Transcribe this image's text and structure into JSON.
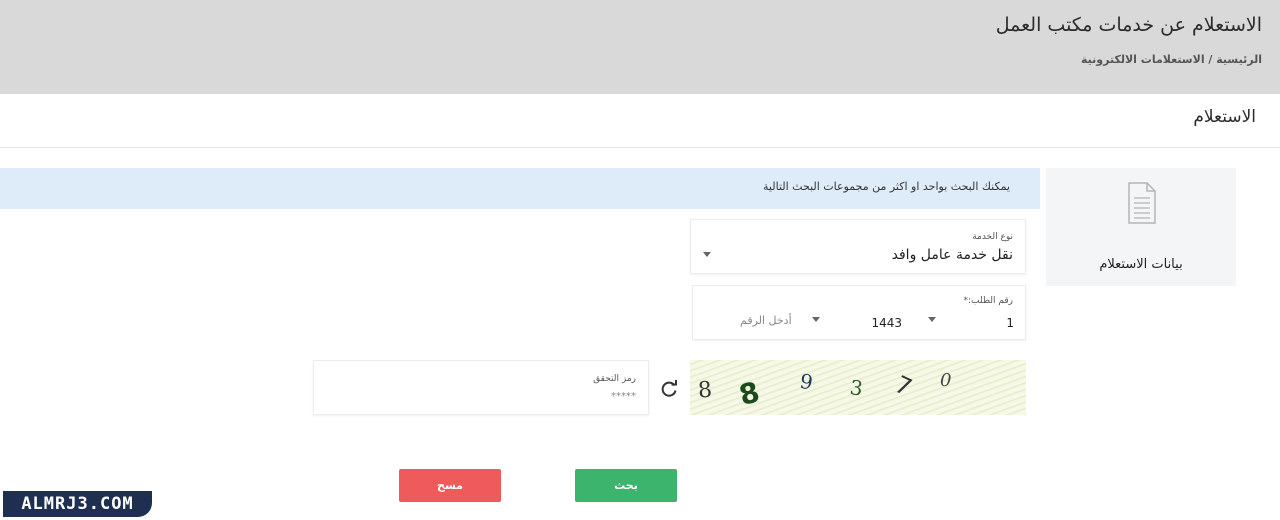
{
  "header": {
    "title": "الاستعلام عن خدمات مكتب العمل",
    "breadcrumb": "الرئيسية / الاستعلامات الالكترونية"
  },
  "card": {
    "title": "الاستعلام"
  },
  "side_tab": {
    "label": "بيانات الاستعلام",
    "icon": "document-icon"
  },
  "info_banner": {
    "text": "يمكنك البحث بواحد او اكثر من مجموعات البحث التالية"
  },
  "service_type": {
    "label": "نوع الخدمة",
    "value": "نقل خدمة عامل وافد"
  },
  "request_number": {
    "label": "رقم الطلب:*",
    "part1": "1",
    "year": "1443",
    "placeholder": "أدخل الرقم"
  },
  "captcha": {
    "digits": [
      "8",
      "8",
      "9",
      "3",
      "7",
      "0"
    ],
    "label": "رمز التحقق",
    "value": "*****"
  },
  "buttons": {
    "search": "بحث",
    "clear": "مسح"
  },
  "watermark": "ALMRJ3.COM",
  "colors": {
    "search_button": "#3cb46e",
    "clear_button": "#ef5b5b",
    "info_banner": "#ddecf8",
    "header_bg": "#d9d9d9"
  }
}
